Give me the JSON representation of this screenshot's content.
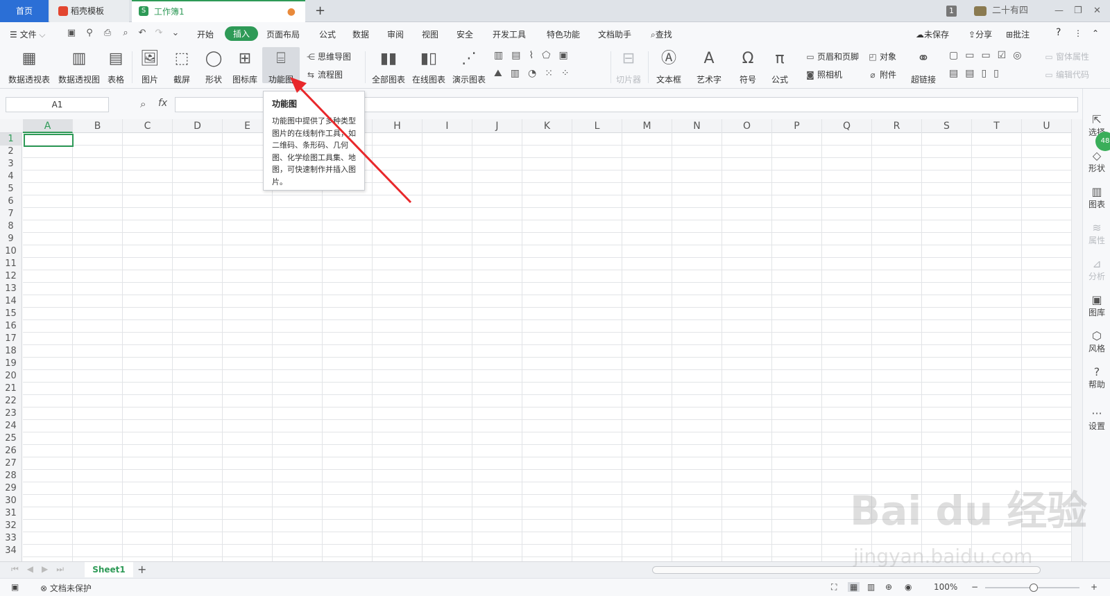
{
  "tabs": {
    "home": "首页",
    "template": "稻壳模板",
    "workbook": "工作簿1",
    "new": "+",
    "badge": "1",
    "user": "二十有四"
  },
  "menu": {
    "file": "文件",
    "items": [
      "开始",
      "插入",
      "页面布局",
      "公式",
      "数据",
      "审阅",
      "视图",
      "安全",
      "开发工具",
      "特色功能",
      "文档助手"
    ],
    "search": "查找",
    "unsaved": "未保存",
    "share": "分享",
    "comment": "批注",
    "help": "?"
  },
  "ribbon": {
    "pivot_table": "数据透视表",
    "pivot_chart": "数据透视图",
    "table": "表格",
    "picture": "图片",
    "screenshot": "截屏",
    "shape": "形状",
    "icon_lib": "图标库",
    "function_chart": "功能图",
    "mind_map": "思维导图",
    "flowchart": "流程图",
    "all_charts": "全部图表",
    "online_chart": "在线图表",
    "demo_chart": "演示图表",
    "slicer": "切片器",
    "textbox": "文本框",
    "wordart": "艺术字",
    "symbol": "符号",
    "formula": "公式",
    "header_footer": "页眉和页脚",
    "object": "对象",
    "camera": "照相机",
    "attachment": "附件",
    "hyperlink": "超链接",
    "window_props": "窗体属性",
    "edit_code": "编辑代码"
  },
  "formula": {
    "cell": "A1",
    "fx": "fx"
  },
  "columns": [
    "A",
    "B",
    "C",
    "D",
    "E",
    "F",
    "G",
    "H",
    "I",
    "J",
    "K",
    "L",
    "M",
    "N",
    "O",
    "P",
    "Q",
    "R",
    "S",
    "T",
    "U"
  ],
  "rows": [
    "1",
    "2",
    "3",
    "4",
    "5",
    "6",
    "7",
    "8",
    "9",
    "10",
    "11",
    "12",
    "13",
    "14",
    "15",
    "16",
    "17",
    "18",
    "19",
    "20",
    "21",
    "22",
    "23",
    "24",
    "25",
    "26",
    "27",
    "28",
    "29",
    "30",
    "31",
    "32",
    "33",
    "34"
  ],
  "tooltip": {
    "title": "功能图",
    "body": "功能图中提供了多种类型图片的在线制作工具，如二维码、条形码、几何图、化学绘图工具集、地图，可快速制作并插入图片。"
  },
  "right_panel": {
    "select": "选择",
    "shape": "形状",
    "chart": "图表",
    "props": "属性",
    "analysis": "分析",
    "gallery": "图库",
    "style": "风格",
    "help": "帮助",
    "settings": "设置",
    "badge": "48"
  },
  "sheets": {
    "sheet1": "Sheet1",
    "add": "+"
  },
  "status": {
    "protect": "文档未保护",
    "zoom": "100%"
  },
  "watermark": {
    "brand": "Bai du 经验",
    "url": "jingyan.baidu.com"
  },
  "colors": {
    "accent": "#2e9a57",
    "tab_home": "#2b6fd6",
    "arrow": "#e8282b"
  }
}
